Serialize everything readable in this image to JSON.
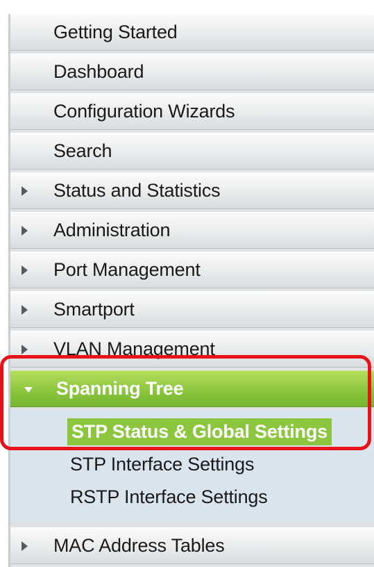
{
  "nav": {
    "items": [
      {
        "label": "Getting Started",
        "has_arrow": false
      },
      {
        "label": "Dashboard",
        "has_arrow": false
      },
      {
        "label": "Configuration Wizards",
        "has_arrow": false
      },
      {
        "label": "Search",
        "has_arrow": false
      },
      {
        "label": "Status and Statistics",
        "has_arrow": true
      },
      {
        "label": "Administration",
        "has_arrow": true
      },
      {
        "label": "Port Management",
        "has_arrow": true
      },
      {
        "label": "Smartport",
        "has_arrow": true
      },
      {
        "label": "VLAN Management",
        "has_arrow": true
      }
    ],
    "active": {
      "label": "Spanning Tree",
      "submenu": [
        {
          "label": "STP Status & Global Settings",
          "selected": true
        },
        {
          "label": "STP Interface Settings",
          "selected": false
        },
        {
          "label": "RSTP Interface Settings",
          "selected": false
        }
      ]
    },
    "after": [
      {
        "label": "MAC Address Tables",
        "has_arrow": true
      }
    ]
  },
  "colors": {
    "active_green": "#8cc63f",
    "highlight_red": "#e8121b",
    "submenu_bg": "#d9e4ec"
  }
}
